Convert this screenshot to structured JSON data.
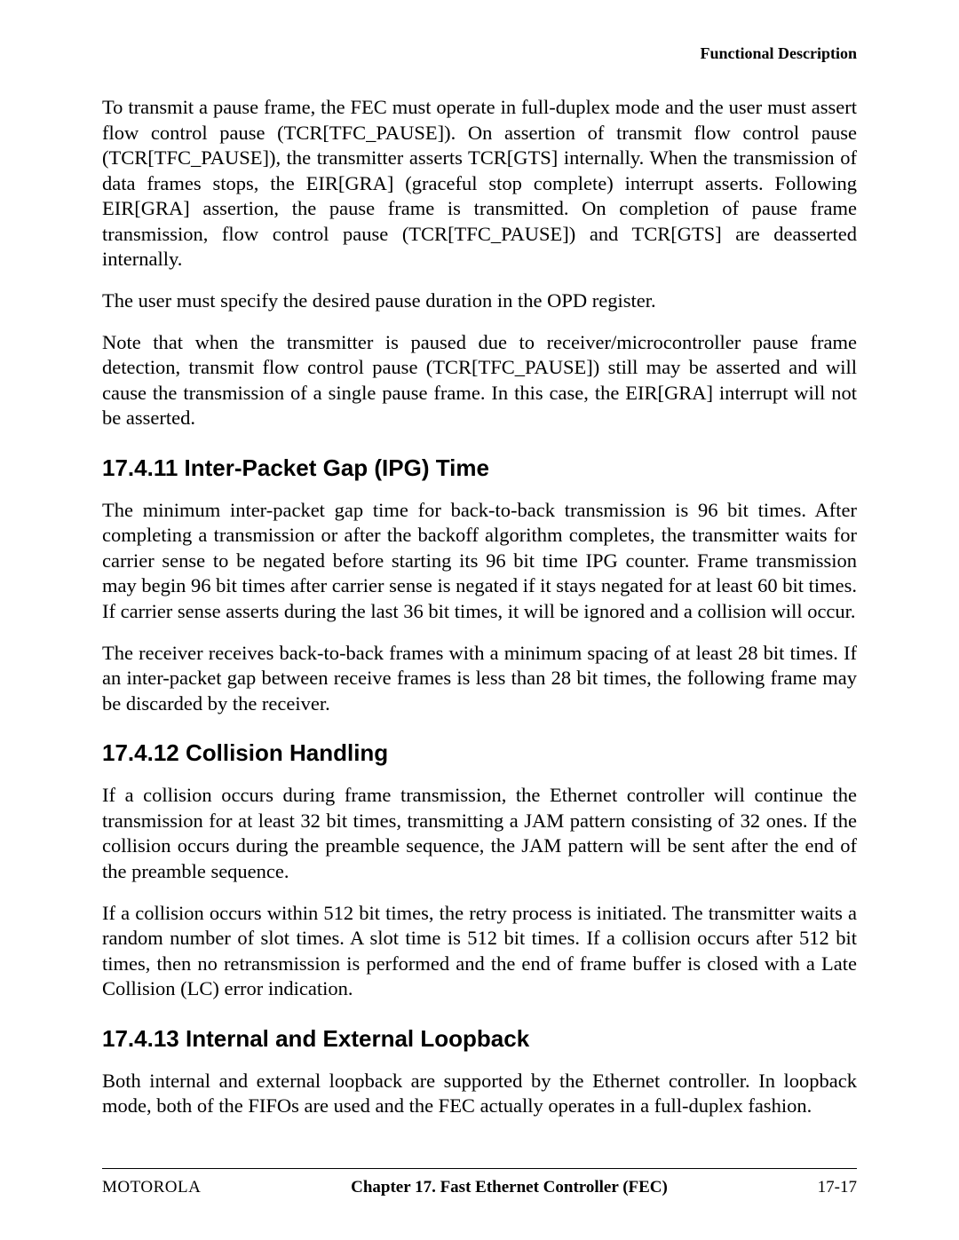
{
  "header": {
    "running_head": "Functional Description"
  },
  "paragraphs": {
    "p1": "To transmit a pause frame, the FEC must operate in full-duplex mode and the user must assert flow control pause (TCR[TFC_PAUSE]). On assertion of transmit flow control pause (TCR[TFC_PAUSE]), the transmitter asserts TCR[GTS] internally. When the transmission of data frames stops, the EIR[GRA] (graceful stop complete) interrupt asserts. Following EIR[GRA] assertion, the pause frame is transmitted. On completion of pause frame transmission, flow control pause (TCR[TFC_PAUSE]) and TCR[GTS] are deasserted internally.",
    "p2": "The user must specify the desired pause duration in the OPD register.",
    "p3": "Note that when the transmitter is paused due to receiver/microcontroller pause frame detection, transmit flow control pause (TCR[TFC_PAUSE]) still may be asserted and will cause the transmission of a single pause frame. In this case, the EIR[GRA] interrupt will not be asserted.",
    "p4": "The minimum inter-packet gap time for back-to-back transmission is 96 bit times. After completing a transmission or after the backoff algorithm completes, the transmitter waits for carrier sense to be negated before starting its 96 bit time IPG counter. Frame transmission may begin 96 bit times after carrier sense is negated if it stays negated for at least 60 bit times. If carrier sense asserts during the last 36 bit times, it will be ignored and a collision will occur.",
    "p5": "The receiver receives back-to-back frames with a minimum spacing of at least 28 bit times. If an inter-packet gap between receive frames is less than 28 bit times, the following frame may be discarded by the receiver.",
    "p6": "If a collision occurs during frame transmission, the Ethernet controller will continue the transmission for at least 32 bit times, transmitting a JAM pattern consisting of 32 ones. If the collision occurs during the preamble sequence, the JAM pattern will be sent after the end of the preamble sequence.",
    "p7": "If a collision occurs within 512 bit times, the retry process is initiated. The transmitter waits a random number of slot times. A slot time is 512 bit times. If a collision occurs after 512 bit times, then no retransmission is performed and the end of frame buffer is closed with a Late Collision (LC) error indication.",
    "p8": "Both internal and external loopback are supported by the Ethernet controller. In loopback mode, both of the FIFOs are used and the FEC actually operates in a full-duplex fashion."
  },
  "headings": {
    "h1": "17.4.11 Inter-Packet Gap (IPG) Time",
    "h2": "17.4.12 Collision Handling",
    "h3": "17.4.13 Internal and External Loopback"
  },
  "footer": {
    "left": "MOTOROLA",
    "center": "Chapter 17.  Fast Ethernet Controller (FEC)",
    "right": "17-17"
  }
}
